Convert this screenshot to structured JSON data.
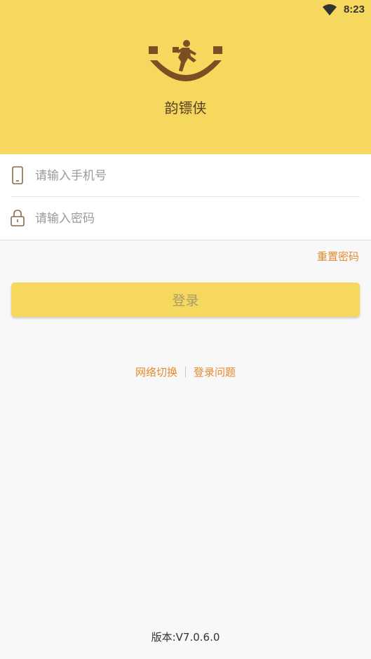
{
  "status_bar": {
    "time": "8:23",
    "icons": [
      "wifi-icon"
    ]
  },
  "header": {
    "app_name": "韵镖侠",
    "logo": "courier-smile-logo"
  },
  "form": {
    "phone": {
      "placeholder": "请输入手机号",
      "value": "",
      "icon": "phone-icon"
    },
    "password": {
      "placeholder": "请输入密码",
      "value": "",
      "icon": "lock-icon"
    }
  },
  "reset_password": "重置密码",
  "login_button": "登录",
  "links": {
    "network_switch": "网络切换",
    "login_issue": "登录问题"
  },
  "version": "版本:V7.0.6.0",
  "colors": {
    "header_bg": "#f6d85e",
    "accent": "#e68a2e",
    "brand_brown": "#7a4f24"
  }
}
